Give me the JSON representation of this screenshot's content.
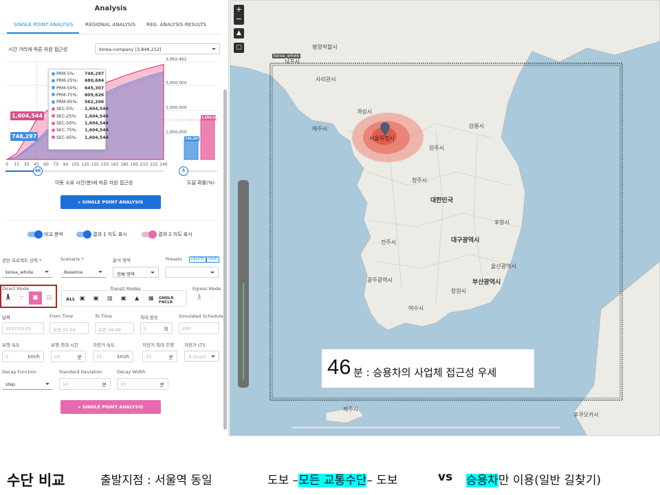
{
  "panel": {
    "title": "Analysis",
    "tabs": [
      "SINGLE POINT ANALYSIS",
      "REGIONAL ANALYSIS",
      "REG. ANALYSIS RESULTS"
    ],
    "chart_section_label": "시간 거리에 따른 자원 접근성",
    "dataset_select": "korea-company [3,848,212]",
    "chart_xlabel": "이동 소요 시간(분)에 따른 자원 접근성",
    "chart_rlabel": "도달 확률(%)",
    "time_slider_value": "46",
    "prob_slider_value": "5",
    "run_button": "SINGLE POINT ANALYSIS",
    "toggles": [
      "비교 분석",
      "결과 1 지도 표시",
      "결과 2 지도 표시"
    ],
    "project_label": "관련 프로젝트 선택 *",
    "project_value": "korea_whole",
    "scenario_label": "Scenario *",
    "scenario_value": "Baseline",
    "region_label": "분석 영역",
    "region_value": "전체 영역",
    "presets_label": "Presets",
    "delete_btn": "DELETE",
    "save_btn": "SAVE",
    "direct_mode_label": "Direct Mode",
    "transit_modes_label": "Transit Modes",
    "egress_mode_label": "Egress Mode",
    "transit_all": "ALL",
    "transit_last": "GNDLR FNCLR",
    "date_label": "날짜",
    "date_value": "2017-01-01",
    "from_label": "From Time",
    "from_value": "오전 07:00",
    "to_label": "To Time",
    "to_value": "오전 09:00",
    "max_transfer_label": "최대 환승",
    "max_transfer_value": "5",
    "max_transfer_unit": "회",
    "sim_label": "Simulated Schedule",
    "sim_value": "200",
    "walk_speed_label": "보행 속도",
    "walk_speed_value": "5",
    "walk_speed_unit": "km/h",
    "walk_max_label": "보행 최대 시간",
    "walk_max_value": "20",
    "walk_max_unit": "분",
    "bike_speed_label": "자전거 속도",
    "bike_speed_value": "15",
    "bike_speed_unit": "km/h",
    "bike_max_label": "자전거 최대 주행",
    "bike_max_value": "20",
    "bike_max_unit": "분",
    "bike_lts_label": "자전거 LTS",
    "bike_lts_value": "4 (max)",
    "decay_fn_label": "Decay Function",
    "decay_fn_value": "step",
    "std_label": "Standard Deviation",
    "std_value": "10",
    "std_unit": "분",
    "decay_w_label": "Decay Width",
    "decay_w_value": "10",
    "decay_w_unit": "분",
    "run_button_2": "SINGLE POINT ANALYSIS"
  },
  "chart_data": {
    "type": "area",
    "x": [
      0,
      15,
      30,
      45,
      60,
      75,
      90,
      105,
      120,
      135,
      150,
      165,
      180,
      195,
      210,
      225,
      240
    ],
    "x_ticks": [
      "0",
      "15",
      "30",
      "45",
      "60",
      "75",
      "90",
      "105",
      "120",
      "135",
      "150",
      "165",
      "180",
      "195",
      "210",
      "225",
      "240"
    ],
    "y_ticks": [
      "3,962,462",
      "3,000,000",
      "2,000,000",
      "1,000,000"
    ],
    "ylim": [
      0,
      3962462
    ],
    "series": [
      {
        "name": "PRM-5%",
        "color": "#42a5f5",
        "values": [
          0,
          120000,
          420000,
          748297,
          1150000,
          1500000,
          1800000,
          2050000,
          2300000,
          2500000,
          2700000,
          2880000,
          3050000,
          3200000,
          3330000,
          3450000,
          3560000
        ]
      },
      {
        "name": "PRM-25%",
        "color": "#64b5f6",
        "values": [
          0,
          100000,
          380000,
          680684,
          1050000,
          1400000,
          1700000,
          1950000,
          2200000,
          2420000,
          2620000,
          2800000,
          2980000,
          3130000,
          3260000,
          3380000,
          3480000
        ]
      },
      {
        "name": "PRM-50%",
        "color": "#90caf9",
        "values": [
          0,
          90000,
          350000,
          645307,
          1000000,
          1330000,
          1620000,
          1880000,
          2120000,
          2340000,
          2540000,
          2720000,
          2900000,
          3050000,
          3180000,
          3300000,
          3400000
        ]
      },
      {
        "name": "SEC-5%",
        "color": "#e91e63",
        "values": [
          0,
          250000,
          900000,
          1604544,
          1950000,
          2200000,
          2400000,
          2600000,
          2780000,
          2950000,
          3100000,
          3250000,
          3400000,
          3530000,
          3650000,
          3760000,
          3860000
        ]
      }
    ],
    "tooltip": [
      {
        "name": "PRM-5%:",
        "value": "748,297",
        "color": "#42a5f5"
      },
      {
        "name": "PRM-25%:",
        "value": "680,684",
        "color": "#42a5f5"
      },
      {
        "name": "PRM-50%:",
        "value": "645,307",
        "color": "#42a5f5"
      },
      {
        "name": "PRM-75%:",
        "value": "609,626",
        "color": "#42a5f5"
      },
      {
        "name": "PRM-95%:",
        "value": "562,206",
        "color": "#42a5f5"
      },
      {
        "name": "SEC-5%:",
        "value": "1,604,544",
        "color": "#e0609a"
      },
      {
        "name": "SEC-25%:",
        "value": "1,604,544",
        "color": "#e0609a"
      },
      {
        "name": "SEC-50%:",
        "value": "1,604,544",
        "color": "#e0609a"
      },
      {
        "name": "SEC-75%:",
        "value": "1,604,544",
        "color": "#e0609a"
      },
      {
        "name": "SEC-95%:",
        "value": "1,604,544",
        "color": "#e0609a"
      }
    ],
    "bar_values": [
      {
        "label": "748,297",
        "value": 748297,
        "color": "#3d8fe0"
      },
      {
        "label": "1,604,544",
        "value": 1604544,
        "color": "#e55a99"
      }
    ],
    "badge_blue": "748,297",
    "badge_pink": "1,604,544"
  },
  "map": {
    "labels": [
      {
        "t": "평양직할시",
        "big": false
      },
      {
        "t": "개성시",
        "big": false
      },
      {
        "t": "서울특별시",
        "big": false
      },
      {
        "t": "대한민국",
        "big": true
      },
      {
        "t": "대구광역시",
        "big": true
      },
      {
        "t": "부산광역시",
        "big": true
      },
      {
        "t": "남포시",
        "big": false
      },
      {
        "t": "사리원시",
        "big": false
      },
      {
        "t": "해주시",
        "big": false
      },
      {
        "t": "청주시",
        "big": false
      },
      {
        "t": "전주시",
        "big": false
      },
      {
        "t": "광주광역시",
        "big": false
      },
      {
        "t": "울산광역시",
        "big": false
      },
      {
        "t": "포항시",
        "big": false
      },
      {
        "t": "창원시",
        "big": false
      },
      {
        "t": "강릉시",
        "big": false
      },
      {
        "t": "원주시",
        "big": false
      },
      {
        "t": "여수시",
        "big": false
      },
      {
        "t": "제주시",
        "big": false
      },
      {
        "t": "후쿠오카시",
        "big": false
      }
    ],
    "project_tag": "korea_whole",
    "caption_num": "46",
    "caption_text": "분 : 승용차의 사업체 접근성 우세",
    "accent_blue": "#1e6fd9",
    "accent_pink": "#e86aae"
  },
  "footer": {
    "title": "수단 비교",
    "origin": "출발지점 : 서울역 동일",
    "walk_a": "도보 –",
    "all_modes": "모든 교통수단",
    "walk_b": "– 도보",
    "vs": "vs",
    "car": "승용차",
    "car_rest": "만 이용(일반 길찾기)"
  }
}
